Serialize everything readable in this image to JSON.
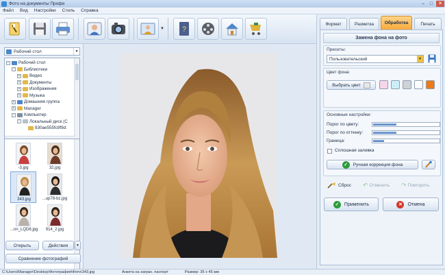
{
  "window": {
    "title": "Фото на документы Профи"
  },
  "menu": [
    "Файл",
    "Вид",
    "Настройки",
    "Стиль",
    "Справка"
  ],
  "toolbar": {
    "icons": [
      "wizard-icon",
      "save-icon",
      "print-icon",
      "user-photo-icon",
      "camera-icon",
      "crop-photo-icon",
      "help-book-icon",
      "film-reel-icon",
      "home-icon",
      "shop-cart-icon"
    ]
  },
  "left": {
    "folder_selected": "Рабочий стол",
    "tree": [
      {
        "label": "Рабочий стол",
        "level": 0,
        "exp": "−"
      },
      {
        "label": "Библиотеки",
        "level": 1,
        "exp": "−"
      },
      {
        "label": "Видео",
        "level": 2,
        "exp": "+"
      },
      {
        "label": "Документы",
        "level": 2,
        "exp": "+"
      },
      {
        "label": "Изображения",
        "level": 2,
        "exp": "+"
      },
      {
        "label": "Музыка",
        "level": 2,
        "exp": "+"
      },
      {
        "label": "Домашняя группа",
        "level": 1,
        "exp": "+"
      },
      {
        "label": "Manager",
        "level": 1,
        "exp": "+"
      },
      {
        "label": "Компьютер",
        "level": 1,
        "exp": "−"
      },
      {
        "label": "Локальный диск (C",
        "level": 2,
        "exp": "−"
      },
      {
        "label": "830ae555fc9f9d:",
        "level": 3,
        "exp": ""
      }
    ],
    "thumbnails": [
      {
        "caption": "-3.jpg",
        "selected": false,
        "bg": "#f3f3f3",
        "body": "#c83f3f",
        "hair": "#7a4b2a"
      },
      {
        "caption": "32.jpg",
        "selected": false,
        "bg": "#e6dccf",
        "body": "#6e3b2a",
        "hair": "#4a2e1c"
      },
      {
        "caption": "343.jpg",
        "selected": true,
        "bg": "#f1f1f1",
        "body": "#222222",
        "hair": "#b88d4d"
      },
      {
        "caption": "...up78-bz.jpg",
        "selected": false,
        "bg": "#e8e8e8",
        "body": "#2d2d2d",
        "hair": "#1f1a17"
      },
      {
        "caption": "...nn_LQD6.jpg",
        "selected": false,
        "bg": "#f0f0f0",
        "body": "#b9b2aa",
        "hair": "#3a2a20"
      },
      {
        "caption": "914_2.jpg",
        "selected": false,
        "bg": "#efefef",
        "body": "#7b2b2b",
        "hair": "#2f231b"
      }
    ],
    "open_label": "Открыть",
    "actions_label": "Действия",
    "compare_label": "Сравнение фотографий"
  },
  "right": {
    "tabs": [
      {
        "label": "Формат",
        "active": false
      },
      {
        "label": "Разметка",
        "active": false
      },
      {
        "label": "Обработка",
        "active": true
      },
      {
        "label": "Печать",
        "active": false
      }
    ],
    "panel_title": "Замена фона на фото",
    "presets_label": "Пресеты:",
    "preset_value": "Пользовательский",
    "bg_color_label": "Цвет фона:",
    "choose_color_label": "Выбрать цвет",
    "swatches": [
      "#f7d6ec",
      "#cdeef8",
      "#cfd2d6",
      "#ffffff",
      "#ee7a17"
    ],
    "basic_label": "Основные настройки:",
    "sliders": [
      {
        "label": "Порог по цвету:",
        "value": 0.35
      },
      {
        "label": "Порог по оттенку:",
        "value": 0.35
      },
      {
        "label": "Граница:",
        "value": 0.17
      }
    ],
    "solid_fill_label": "Сплошная заливка",
    "manual_label": "Ручная коррекция фона",
    "reset_label": "Сброс",
    "undo_label": "Отменить",
    "redo_label": "Повторить",
    "apply_label": "Применить",
    "cancel_label": "Отмена"
  },
  "status": {
    "path": "C:\\Users\\Manager\\Desktop\\Фотография\\Фото\\343.jpg",
    "preset": "Анкета на загран. паспорт",
    "size": "Размер: 35 x 45 мм"
  }
}
